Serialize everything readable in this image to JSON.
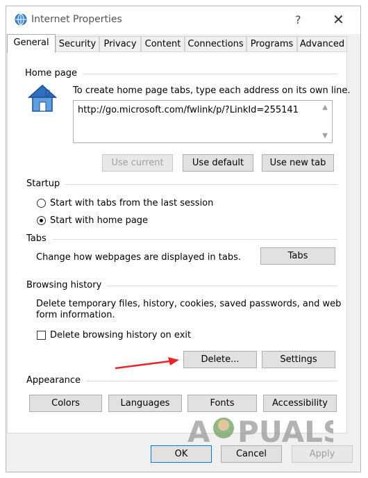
{
  "window": {
    "title": "Internet Properties",
    "help_glyph": "?",
    "close_glyph": "✕"
  },
  "tabs": [
    {
      "label": "General",
      "active": true
    },
    {
      "label": "Security"
    },
    {
      "label": "Privacy"
    },
    {
      "label": "Content"
    },
    {
      "label": "Connections"
    },
    {
      "label": "Programs"
    },
    {
      "label": "Advanced"
    }
  ],
  "home_page": {
    "title": "Home page",
    "instruction": "To create home page tabs, type each address on its own line.",
    "url": "http://go.microsoft.com/fwlink/p/?LinkId=255141",
    "use_current": "Use current",
    "use_default": "Use default",
    "use_new_tab": "Use new tab"
  },
  "startup": {
    "title": "Startup",
    "option_last_session": "Start with tabs from the last session",
    "option_home_page": "Start with home page",
    "selected": "home_page"
  },
  "tabs_section": {
    "title": "Tabs",
    "description": "Change how webpages are displayed in tabs.",
    "button": "Tabs"
  },
  "browsing_history": {
    "title": "Browsing history",
    "description_line1": "Delete temporary files, history, cookies, saved passwords, and web",
    "description_line2": "form information.",
    "delete_on_exit": "Delete browsing history on exit",
    "delete_on_exit_checked": false,
    "delete_button": "Delete...",
    "settings_button": "Settings"
  },
  "appearance": {
    "title": "Appearance",
    "colors": "Colors",
    "languages": "Languages",
    "fonts": "Fonts",
    "accessibility": "Accessibility"
  },
  "footer": {
    "ok": "OK",
    "cancel": "Cancel",
    "apply": "Apply"
  },
  "watermark": {
    "text": "APPUALS"
  },
  "colors": {
    "arrow": "#e8262a",
    "accent": "#0078d7",
    "house_blue": "#2f6fc0"
  }
}
